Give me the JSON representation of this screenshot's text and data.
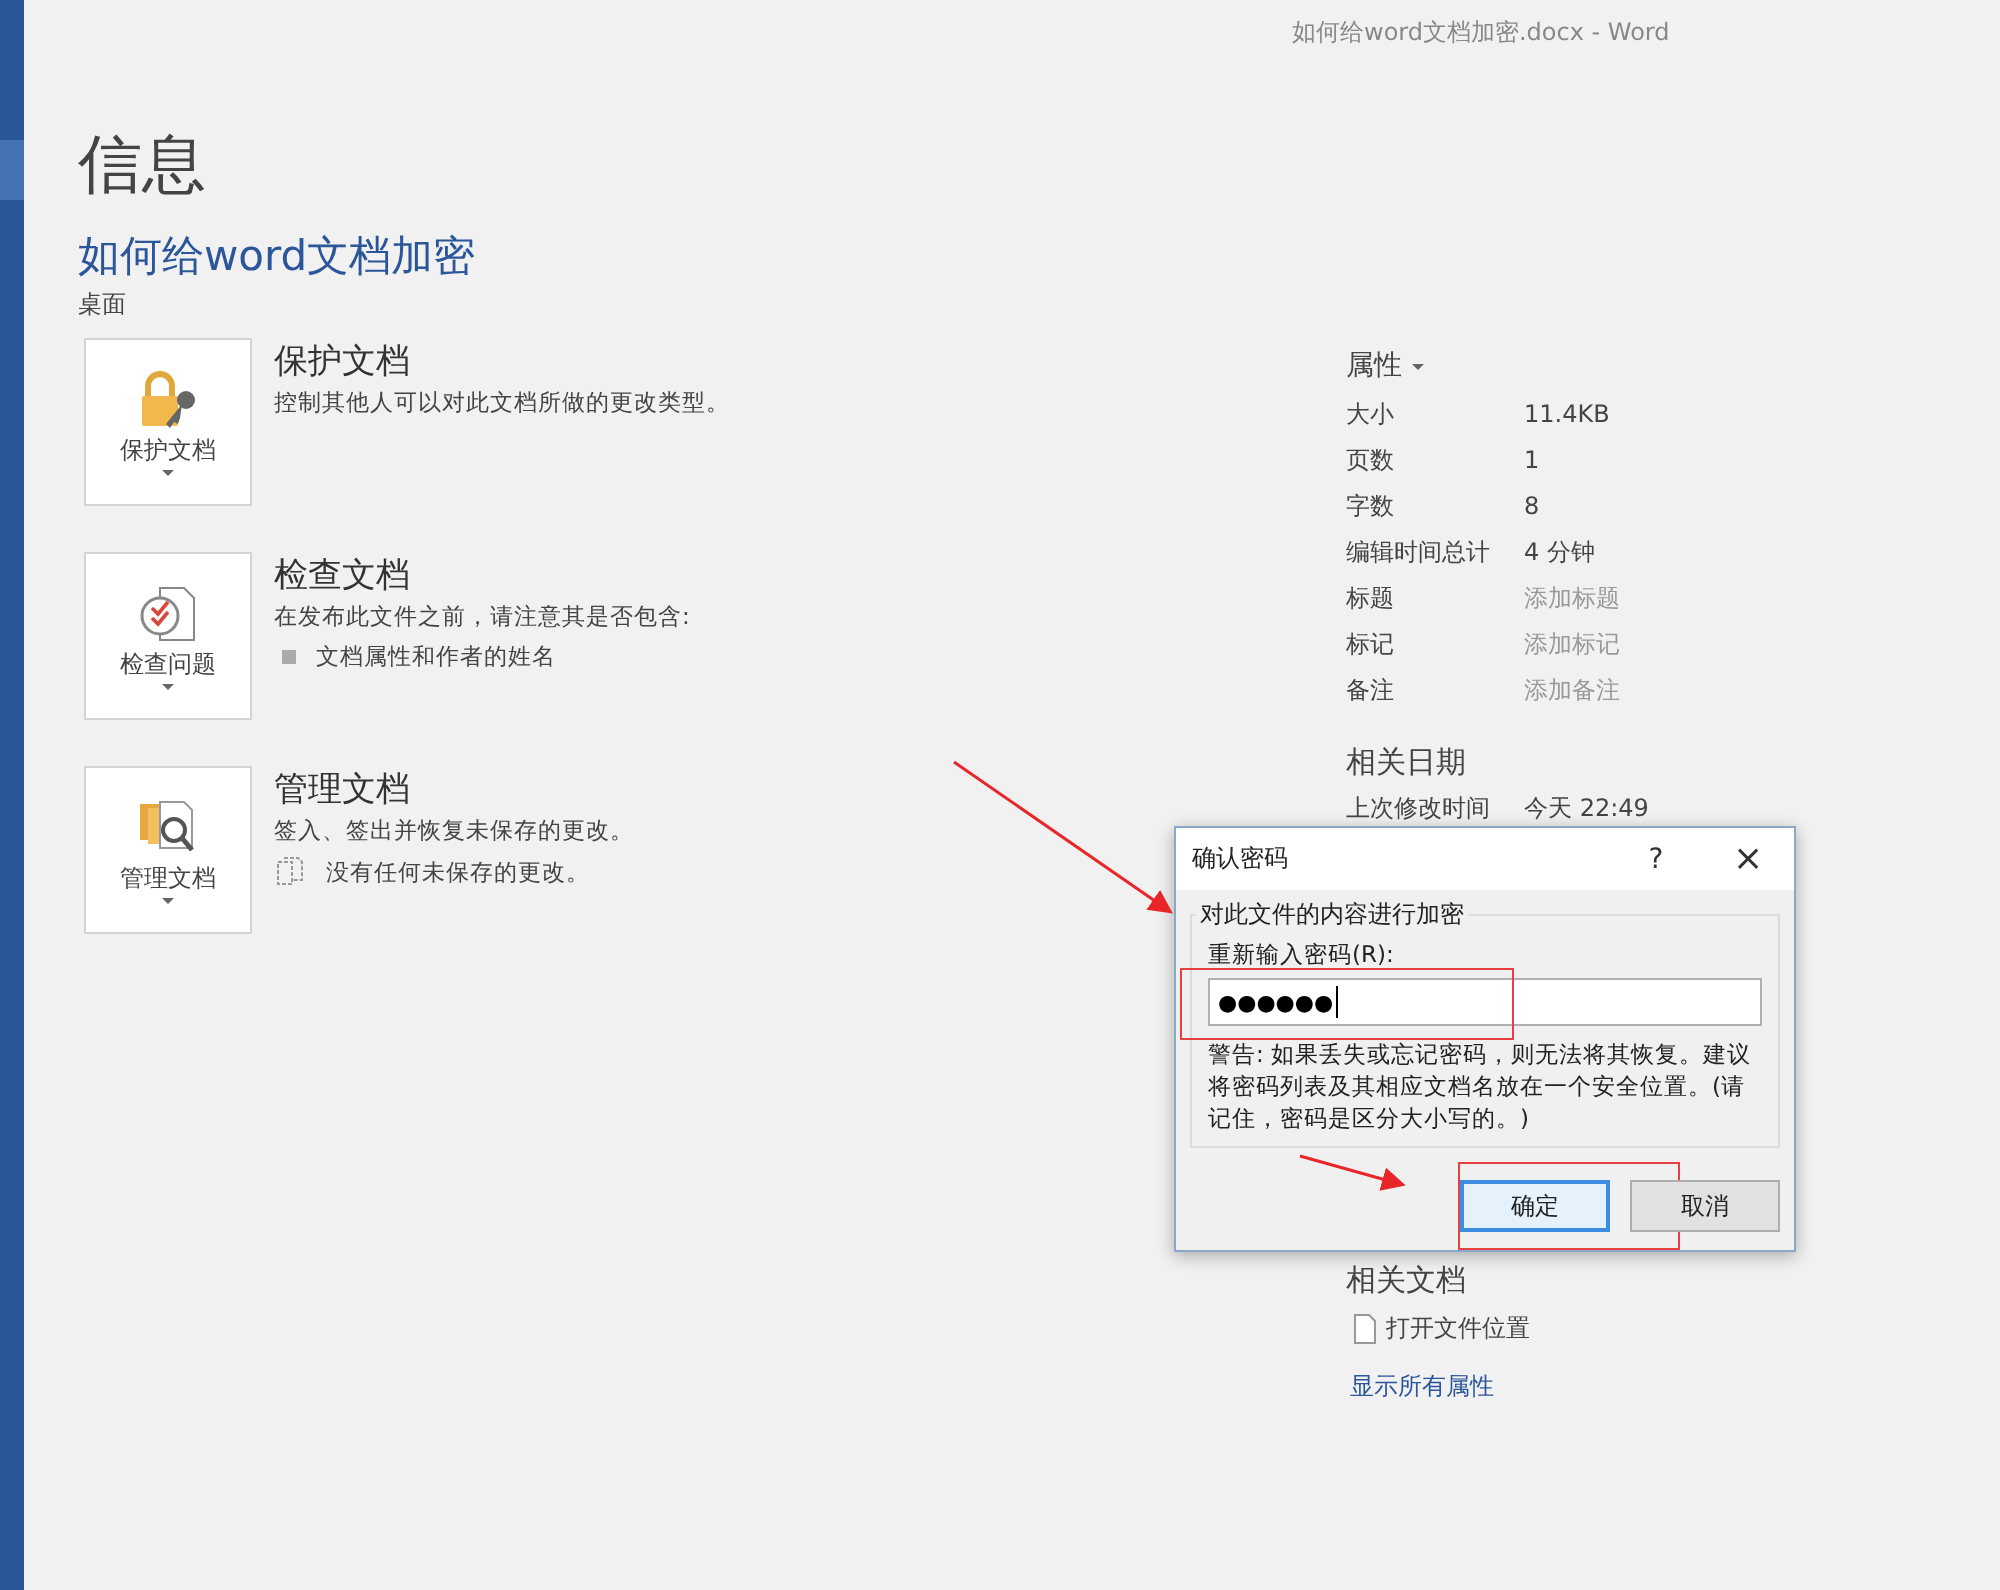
{
  "window": {
    "title": "如何给word文档加密.docx - Word"
  },
  "page": {
    "heading": "信息",
    "doc_title": "如何给word文档加密",
    "location": "桌面"
  },
  "sections": [
    {
      "kind": "protect",
      "button": "保护文档",
      "heading": "保护文档",
      "description": "控制其他人可以对此文档所做的更改类型。"
    },
    {
      "kind": "inspect",
      "button": "检查问题",
      "heading": "检查文档",
      "description": "在发布此文件之前，请注意其是否包含:",
      "bullets": [
        "文档属性和作者的姓名"
      ]
    },
    {
      "kind": "manage",
      "button": "管理文档",
      "heading": "管理文档",
      "description": "签入、签出并恢复未保存的更改。",
      "note": "没有任何未保存的更改。"
    }
  ],
  "properties": {
    "heading": "属性",
    "rows": [
      {
        "label": "大小",
        "value": "11.4KB"
      },
      {
        "label": "页数",
        "value": "1"
      },
      {
        "label": "字数",
        "value": "8"
      },
      {
        "label": "编辑时间总计",
        "value": "4 分钟"
      },
      {
        "label": "标题",
        "placeholder": "添加标题"
      },
      {
        "label": "标记",
        "placeholder": "添加标记"
      },
      {
        "label": "备注",
        "placeholder": "添加备注"
      }
    ]
  },
  "related_dates": {
    "heading": "相关日期",
    "rows": [
      {
        "label": "上次修改时间",
        "value": "今天 22:49"
      }
    ]
  },
  "related_documents": {
    "heading": "相关文档",
    "open_location": "打开文件位置",
    "show_all": "显示所有属性"
  },
  "dialog": {
    "title": "确认密码",
    "help": "?",
    "close": "×",
    "group": "对此文件的内容进行加密",
    "field_label": "重新输入密码(R):",
    "value": "●●●●●●",
    "warning": "警告: 如果丢失或忘记密码，则无法将其恢复。建议将密码列表及其相应文档名放在一个安全位置。(请记住，密码是区分大小写的。)",
    "buttons": [
      {
        "label": "确定",
        "selected": true
      },
      {
        "label": "取消",
        "selected": false
      }
    ]
  }
}
